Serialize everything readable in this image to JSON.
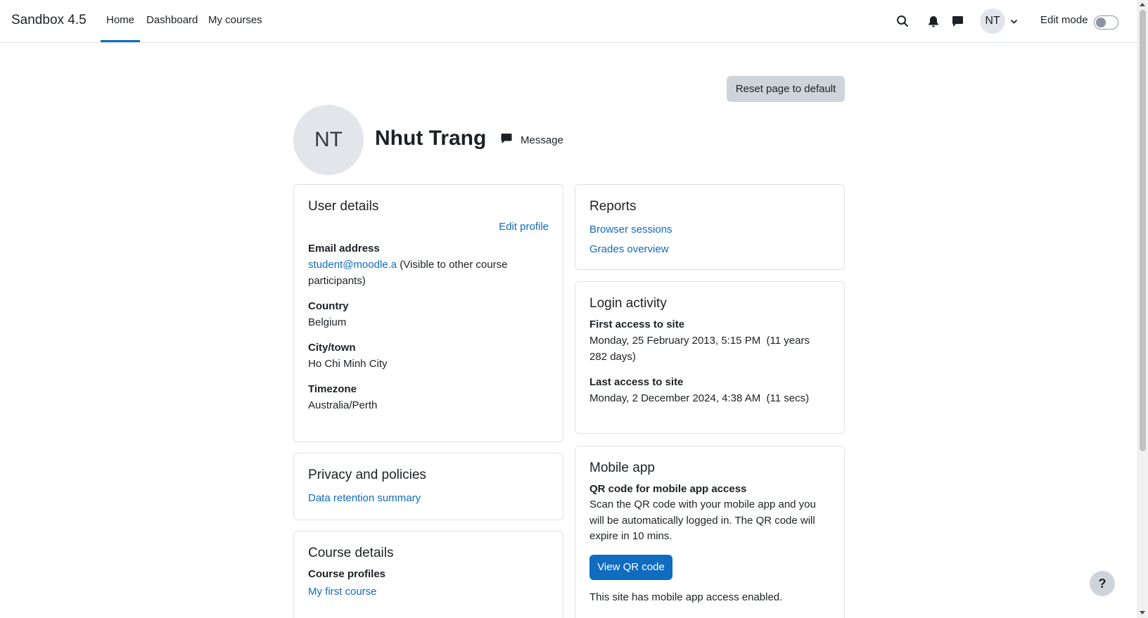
{
  "navbar": {
    "brand": "Sandbox 4.5",
    "links": [
      "Home",
      "Dashboard",
      "My courses"
    ],
    "avatar_initials": "NT",
    "edit_mode_label": "Edit mode"
  },
  "page": {
    "reset_button": "Reset page to default",
    "profile": {
      "initials": "NT",
      "name": "Nhut Trang",
      "message_label": "Message"
    }
  },
  "user_details": {
    "title": "User details",
    "edit_profile": "Edit profile",
    "email_label": "Email address",
    "email_value": "student@moodle.a",
    "email_note": " (Visible to other course participants)",
    "country_label": "Country",
    "country_value": "Belgium",
    "city_label": "City/town",
    "city_value": "Ho Chi Minh City",
    "timezone_label": "Timezone",
    "timezone_value": "Australia/Perth"
  },
  "privacy": {
    "title": "Privacy and policies",
    "link": "Data retention summary"
  },
  "course_details": {
    "title": "Course details",
    "profiles_label": "Course profiles",
    "course_link": "My first course"
  },
  "reports": {
    "title": "Reports",
    "links": [
      "Browser sessions",
      "Grades overview"
    ]
  },
  "login_activity": {
    "title": "Login activity",
    "first_label": "First access to site",
    "first_value": "Monday, 25 February 2013, 5:15 PM  (11 years 282 days)",
    "last_label": "Last access to site",
    "last_value": "Monday, 2 December 2024, 4:38 AM  (11 secs)"
  },
  "mobile_app": {
    "title": "Mobile app",
    "qr_label": "QR code for mobile app access",
    "qr_description": "Scan the QR code with your mobile app and you will be automatically logged in. The QR code will expire in 10 mins.",
    "qr_button": "View QR code",
    "status": "This site has mobile app access enabled."
  },
  "help_button": "?",
  "colors": {
    "accent": "#0f6cbf",
    "secondary_button": "#ced4da",
    "avatar_bg": "#e2e6ea",
    "border": "#dee2e6"
  }
}
